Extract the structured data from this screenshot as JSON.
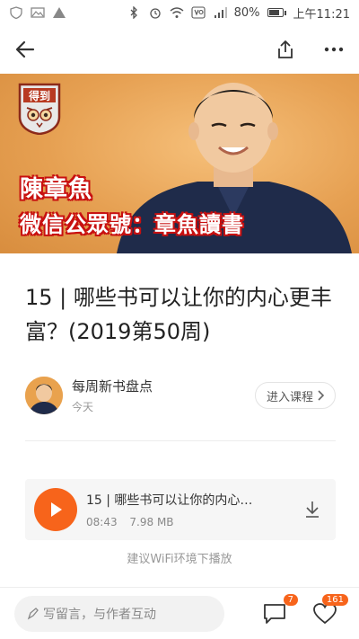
{
  "status_bar": {
    "battery": "80%",
    "time": "上午11:21",
    "battery_level": 0.8,
    "icons": [
      "shield-icon",
      "image-icon",
      "alert-icon",
      "bluetooth-icon",
      "alarm-icon",
      "wifi-icon",
      "volte-icon",
      "signal-icon",
      "battery-icon"
    ]
  },
  "navbar": {
    "icons": [
      "back-arrow-icon",
      "share-icon",
      "more-icon"
    ]
  },
  "cover": {
    "overlay_line1": "陳章魚",
    "overlay_line2": "微信公眾號：章魚讀書",
    "logo_text": "得到"
  },
  "article": {
    "title": "15 | 哪些书可以让你的内心更丰富？(2019第50周)"
  },
  "author": {
    "name": "每周新书盘点",
    "time": "今天",
    "enter_label": "进入课程"
  },
  "audio": {
    "title": "15 | 哪些书可以让你的内心…",
    "duration": "08:43",
    "size": "7.98 MB"
  },
  "wifi_tip": "建议WiFi环境下播放",
  "bottom_bar": {
    "comment_placeholder": "写留言，与作者互动",
    "comment_count": "7",
    "like_count": "161"
  },
  "colors": {
    "accent": "#f7641b",
    "overlay_red": "#c81010"
  }
}
